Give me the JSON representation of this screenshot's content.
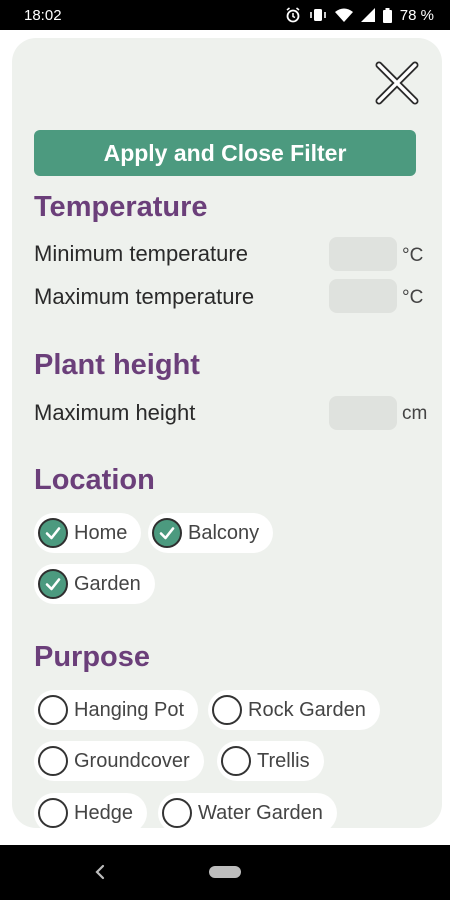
{
  "status_bar": {
    "time": "18:02",
    "battery_percent": "78 %",
    "icons": [
      "alarm-icon",
      "vibrate-icon",
      "wifi-icon",
      "signal-icon",
      "battery-icon"
    ]
  },
  "filter": {
    "apply_label": "Apply and Close Filter",
    "temperature": {
      "title": "Temperature",
      "min_label": "Minimum temperature",
      "min_value": "",
      "max_label": "Maximum temperature",
      "max_value": "",
      "unit": "°C"
    },
    "plant_height": {
      "title": "Plant height",
      "max_label": "Maximum height",
      "max_value": "",
      "unit": "cm"
    },
    "location": {
      "title": "Location",
      "options": [
        {
          "label": "Home",
          "checked": true
        },
        {
          "label": "Balcony",
          "checked": true
        },
        {
          "label": "Garden",
          "checked": true
        }
      ]
    },
    "purpose": {
      "title": "Purpose",
      "options": [
        {
          "label": "Hanging Pot",
          "checked": false
        },
        {
          "label": "Rock Garden",
          "checked": false
        },
        {
          "label": "Groundcover",
          "checked": false
        },
        {
          "label": "Trellis",
          "checked": false
        },
        {
          "label": "Hedge",
          "checked": false
        },
        {
          "label": "Water Garden",
          "checked": false
        }
      ]
    }
  },
  "colors": {
    "accent": "#4c9a7f",
    "heading": "#6b3f7a",
    "card": "#eef1ed"
  }
}
